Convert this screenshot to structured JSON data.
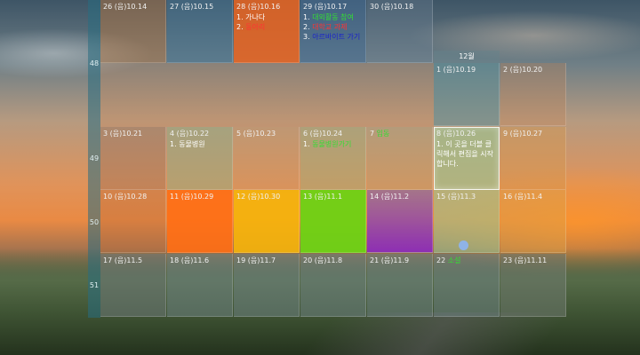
{
  "month_label": "12월",
  "week_numbers": [
    "48",
    "49",
    "50",
    "51"
  ],
  "cells": [
    {
      "date": "26 (음)10.14",
      "items": []
    },
    {
      "date": "27 (음)10.15",
      "items": []
    },
    {
      "date": "28 (음)10.16",
      "items": [
        {
          "text": "1. 가나다",
          "color": "#ffffff"
        },
        {
          "text": "2. 동아리",
          "color": "#ff3333",
          "prefix": "2.",
          "label": "동아리"
        }
      ]
    },
    {
      "date": "29 (음)10.17",
      "items": [
        {
          "prefix": "1.",
          "label": "대외활동 참여",
          "color": "#33dd33"
        },
        {
          "prefix": "2.",
          "label": "대학교 과제",
          "color": "#ff3333"
        },
        {
          "prefix": "3.",
          "label": "아르바이트 가기",
          "color": "#1a22cc"
        }
      ]
    },
    {
      "date": "30 (음)10.18",
      "items": []
    },
    {
      "date": "1 (음)10.19",
      "items": []
    },
    {
      "date": "2 (음)10.20",
      "items": []
    },
    {
      "date": "3 (음)10.21",
      "items": []
    },
    {
      "date": "4 (음)10.22",
      "items": [
        {
          "prefix": "1.",
          "label": "동물병원",
          "color": "#ffffff"
        }
      ]
    },
    {
      "date": "5 (음)10.23",
      "items": []
    },
    {
      "date": "6 (음)10.24",
      "items": [
        {
          "prefix": "1.",
          "label": "동물병원가기",
          "color": "#33dd33"
        }
      ]
    },
    {
      "date": "7 입동",
      "items": []
    },
    {
      "date": "8 (음)10.26",
      "items": [
        {
          "prefix": "1.",
          "label": "이 곳을 더블 클릭해서 편집을 시작합니다.",
          "color": "#ffffff"
        }
      ]
    },
    {
      "date": "9 (음)10.27",
      "items": []
    },
    {
      "date": "10 (음)10.28",
      "items": []
    },
    {
      "date": "11 (음)10.29",
      "items": []
    },
    {
      "date": "12 (음)10.30",
      "items": []
    },
    {
      "date": "13 (음)11.1",
      "items": []
    },
    {
      "date": "14 (음)11.2",
      "items": []
    },
    {
      "date": "15 (음)11.3",
      "items": []
    },
    {
      "date": "16 (음)11.4",
      "items": []
    },
    {
      "date": "17 (음)11.5",
      "items": []
    },
    {
      "date": "18 (음)11.6",
      "items": []
    },
    {
      "date": "19 (음)11.7",
      "items": []
    },
    {
      "date": "20 (음)11.8",
      "items": []
    },
    {
      "date": "21 (음)11.9",
      "items": []
    },
    {
      "date": "22 소설",
      "items": []
    },
    {
      "date": "23 (음)11.11",
      "items": []
    }
  ],
  "colors": {
    "week_strip": "#2a7a8c",
    "orange_cell": "#ff6a00",
    "yellow_cell": "#f0b400",
    "green_cell": "#66dd11",
    "purple_cell": "#8833cc",
    "solar_term_text": "#33dd33"
  }
}
